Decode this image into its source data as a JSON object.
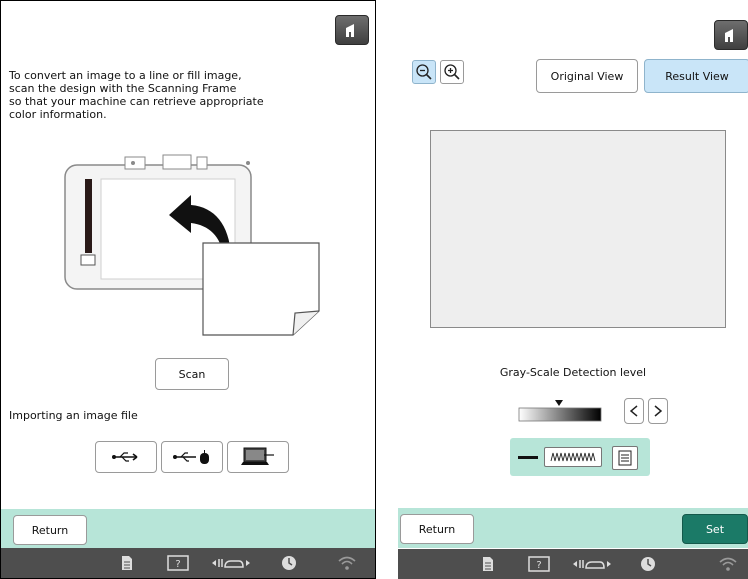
{
  "left": {
    "intro_lines": [
      "To convert an image to a line or fill image,",
      "scan the design with the Scanning Frame",
      "so that your machine can retrieve appropriate",
      "color information."
    ],
    "scan_label": "Scan",
    "import_label": "Importing an image file",
    "import_icons": [
      "usb-icon",
      "usb-mouse-icon",
      "computer-icon"
    ],
    "return_label": "Return"
  },
  "right": {
    "zoom_icons": [
      "zoom-out-icon",
      "zoom-in-icon"
    ],
    "tabs": {
      "original": "Original View",
      "result": "Result View"
    },
    "detection_label": "Gray-Scale Detection level",
    "set_label": "Set",
    "return_label": "Return"
  },
  "statusbar_icons": [
    "document-icon",
    "help-icon",
    "presser-foot-icon",
    "clock-icon",
    "wifi-icon"
  ],
  "colors": {
    "footer_band": "#b7e5d8",
    "statusbar": "#4e4e4e",
    "active_tab": "#c9e5f8",
    "set_button": "#1b7a67",
    "home_button": "#555555",
    "preview_panel": "#eeeeee"
  }
}
